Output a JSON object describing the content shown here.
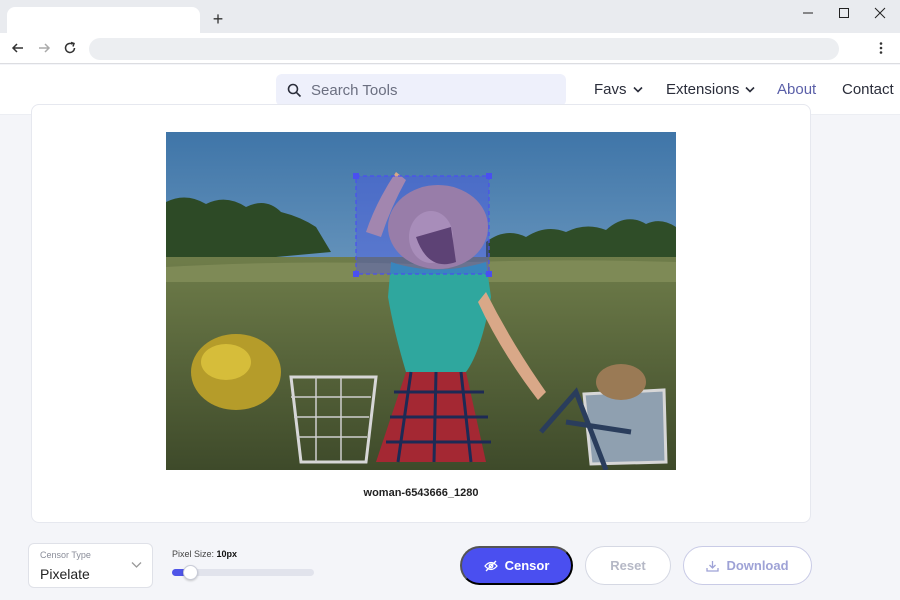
{
  "browser": {
    "new_tab_symbol": "+",
    "icons": [
      "back-arrow-icon",
      "forward-arrow-icon",
      "reload-icon",
      "kebab-menu-icon",
      "minimize-icon",
      "maximize-icon",
      "close-icon"
    ]
  },
  "header": {
    "search_placeholder": "Search Tools",
    "nav": {
      "favs": "Favs",
      "extensions": "Extensions",
      "about": "About",
      "contact": "Contact"
    },
    "active_color": "#5a5fa8"
  },
  "editor": {
    "image_filename": "woman-6543666_1280",
    "selection_color": "#4a4ff0"
  },
  "controls": {
    "censor_type_label": "Censor Type",
    "censor_type_value": "Pixelate",
    "pixel_size_label": "Pixel Size:",
    "pixel_size_value": "10px",
    "pixel_size_fraction": 0.13,
    "censor_button": "Censor",
    "reset_button": "Reset",
    "download_button": "Download",
    "accent_color": "#4a4ff0"
  }
}
